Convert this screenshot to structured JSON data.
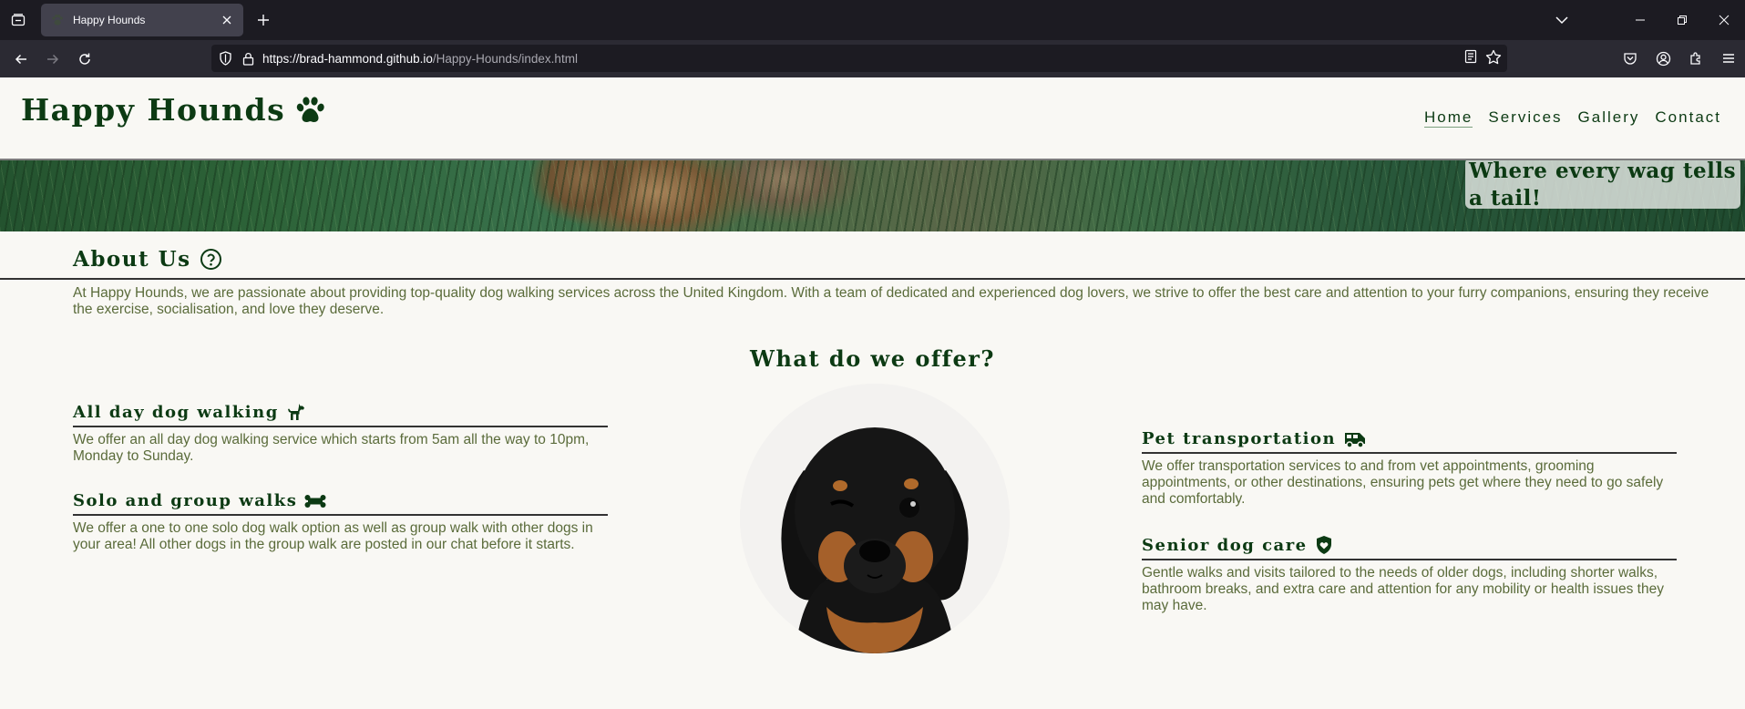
{
  "browser": {
    "tab_title": "Happy Hounds",
    "url_host": "https://brad-hammond.github.io",
    "url_path": "/Happy-Hounds/index.html"
  },
  "site": {
    "logo": "Happy Hounds",
    "nav": [
      "Home",
      "Services",
      "Gallery",
      "Contact"
    ],
    "active_nav": "Home",
    "tagline": "Where every wag tells a tail!"
  },
  "about": {
    "title": "About Us",
    "text": "At Happy Hounds, we are passionate about providing top-quality dog walking services across the United Kingdom. With a team of dedicated and experienced dog lovers, we strive to offer the best care and attention to your furry companions, ensuring they receive the exercise, socialisation, and love they deserve."
  },
  "offer": {
    "title": "What do we offer?",
    "services": [
      {
        "title": "All day dog walking",
        "icon": "dog-icon",
        "text": "We offer an all day dog walking service which starts from 5am all the way to 10pm, Monday to Sunday."
      },
      {
        "title": "Solo and group walks",
        "icon": "bone-icon",
        "text": "We offer a one to one solo dog walk option as well as group walk with other dogs in your area! All other dogs in the group walk are posted in our chat before it starts."
      },
      {
        "title": "Pet transportation",
        "icon": "van-icon",
        "text": "We offer transportation services to and from vet appointments, grooming appointments, or other destinations, ensuring pets get where they need to go safely and comfortably."
      },
      {
        "title": "Senior dog care",
        "icon": "shield-heart-icon",
        "text": "Gentle walks and visits tailored to the needs of older dogs, including shorter walks, bathroom breaks, and extra care and attention for any mobility or health issues they may have."
      }
    ]
  },
  "colors": {
    "brand_green": "#0c3a13",
    "body_text": "#5a6b3a",
    "page_bg": "#f9f8f4"
  }
}
